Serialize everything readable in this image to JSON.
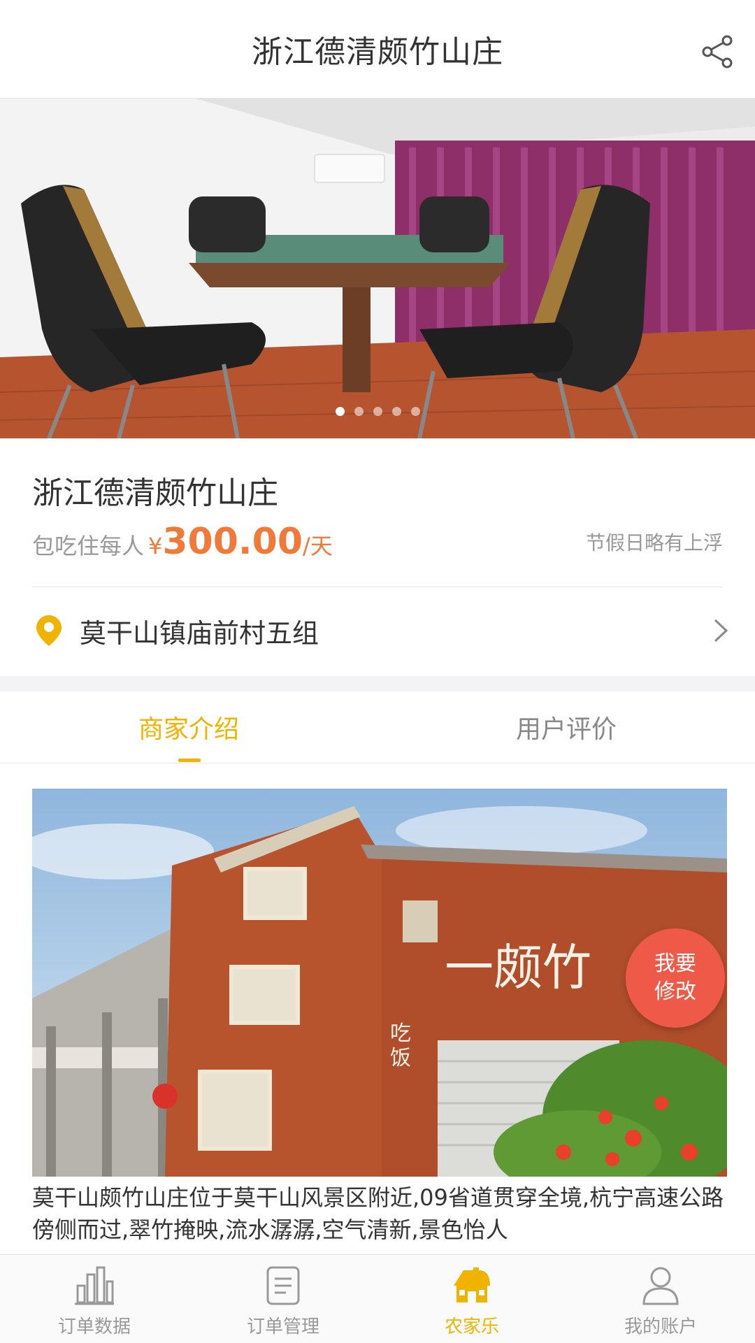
{
  "header": {
    "title": "浙江德清颇竹山庄",
    "share_icon": "share-icon"
  },
  "banner": {
    "slide_count": 5,
    "active_index": 0
  },
  "shop": {
    "name": "浙江德清颇竹山庄",
    "price_prefix": "包吃住每人",
    "currency": "¥",
    "price": "300.00",
    "unit": "/天",
    "holiday_note": "节假日略有上浮",
    "address": "莫干山镇庙前村五组"
  },
  "tabs": [
    {
      "label": "商家介绍",
      "active": true
    },
    {
      "label": "用户评价",
      "active": false
    }
  ],
  "fab": {
    "line1": "我要",
    "line2": "修改"
  },
  "description": "莫干山颇竹山庄位于莫干山风景区附近,09省道贯穿全境,杭宁高速公路傍侧而过,翠竹掩映,流水潺潺,空气清新,景色怡人",
  "tabbar": [
    {
      "label": "订单数据",
      "icon": "bar-chart-icon",
      "active": false
    },
    {
      "label": "订单管理",
      "icon": "document-icon",
      "active": false
    },
    {
      "label": "农家乐",
      "icon": "farmhouse-icon",
      "active": true
    },
    {
      "label": "我的账户",
      "icon": "user-icon",
      "active": false
    }
  ],
  "colors": {
    "accent": "#f0b400",
    "price": "#f07a3a",
    "fab": "#ef5a48"
  }
}
